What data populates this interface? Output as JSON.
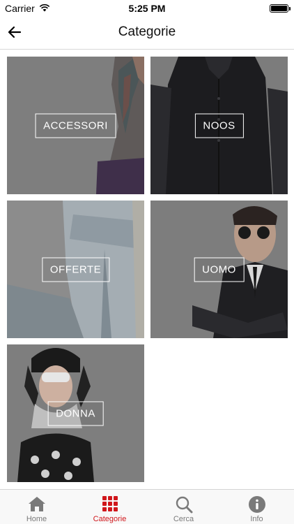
{
  "status_bar": {
    "carrier": "Carrier",
    "time": "5:25 PM"
  },
  "header": {
    "title": "Categorie",
    "back_icon": "back-arrow-icon"
  },
  "categories": [
    {
      "label": "ACCESSORI"
    },
    {
      "label": "NOOS"
    },
    {
      "label": "OFFERTE"
    },
    {
      "label": "UOMO"
    },
    {
      "label": "DONNA"
    }
  ],
  "tab_bar": {
    "active_color": "#d0161b",
    "inactive_color": "#7a7a7a",
    "tabs": [
      {
        "label": "Home",
        "icon": "home-icon"
      },
      {
        "label": "Categorie",
        "icon": "grid-icon",
        "active": true
      },
      {
        "label": "Cerca",
        "icon": "search-icon"
      },
      {
        "label": "Info",
        "icon": "info-icon"
      }
    ]
  }
}
